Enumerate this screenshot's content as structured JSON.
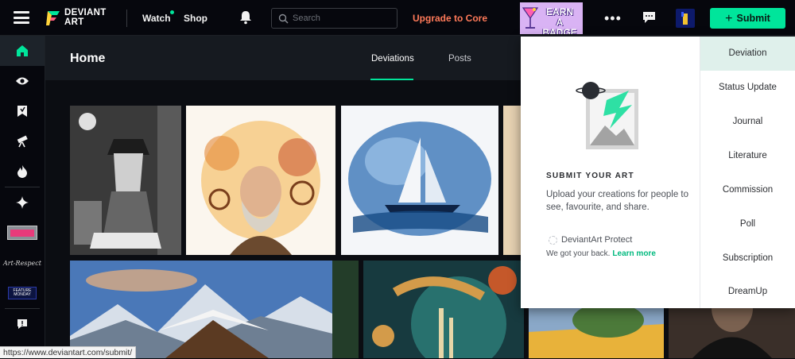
{
  "topbar": {
    "logo_text_line1": "DEVIANT",
    "logo_text_line2": "ART",
    "nav": [
      {
        "label": "Watch"
      },
      {
        "label": "Shop"
      }
    ],
    "search_placeholder": "Search",
    "upgrade_label": "Upgrade to Core",
    "badge_line1": "EARN",
    "badge_line2": "A BADGE",
    "more_label": "•••",
    "submit_label": "Submit",
    "colors": {
      "accent": "#00e59b",
      "upgrade": "#ff7a59",
      "bar_bg": "#06070d"
    }
  },
  "sidebar": {
    "items": [
      {
        "icon": "home-icon"
      },
      {
        "icon": "eye-icon"
      },
      {
        "icon": "bookmark-icon"
      },
      {
        "icon": "telescope-icon"
      },
      {
        "icon": "fire-icon"
      },
      {
        "icon": "sparkle-icon"
      },
      {
        "icon": "group-badge-1"
      },
      {
        "icon": "group-badge-2"
      },
      {
        "icon": "group-badge-3"
      },
      {
        "icon": "alert-icon"
      }
    ],
    "group_labels": [
      "Art-Respect",
      "FEATURE MONDAY"
    ]
  },
  "main": {
    "title": "Home",
    "tabs": [
      {
        "label": "Deviations",
        "active": true
      },
      {
        "label": "Posts",
        "active": false
      }
    ]
  },
  "submit_menu": {
    "heading": "SUBMIT YOUR ART",
    "description": "Upload your creations for people to see, favourite, and share.",
    "protect_label": "DeviantArt Protect",
    "protect_sub": "We got your back.",
    "learn_more": "Learn more",
    "items": [
      {
        "label": "Deviation",
        "active": true
      },
      {
        "label": "Status Update"
      },
      {
        "label": "Journal"
      },
      {
        "label": "Literature"
      },
      {
        "label": "Commission"
      },
      {
        "label": "Poll"
      },
      {
        "label": "Subscription"
      },
      {
        "label": "DreamUp"
      }
    ]
  },
  "status_url": "https://www.deviantart.com/submit/"
}
